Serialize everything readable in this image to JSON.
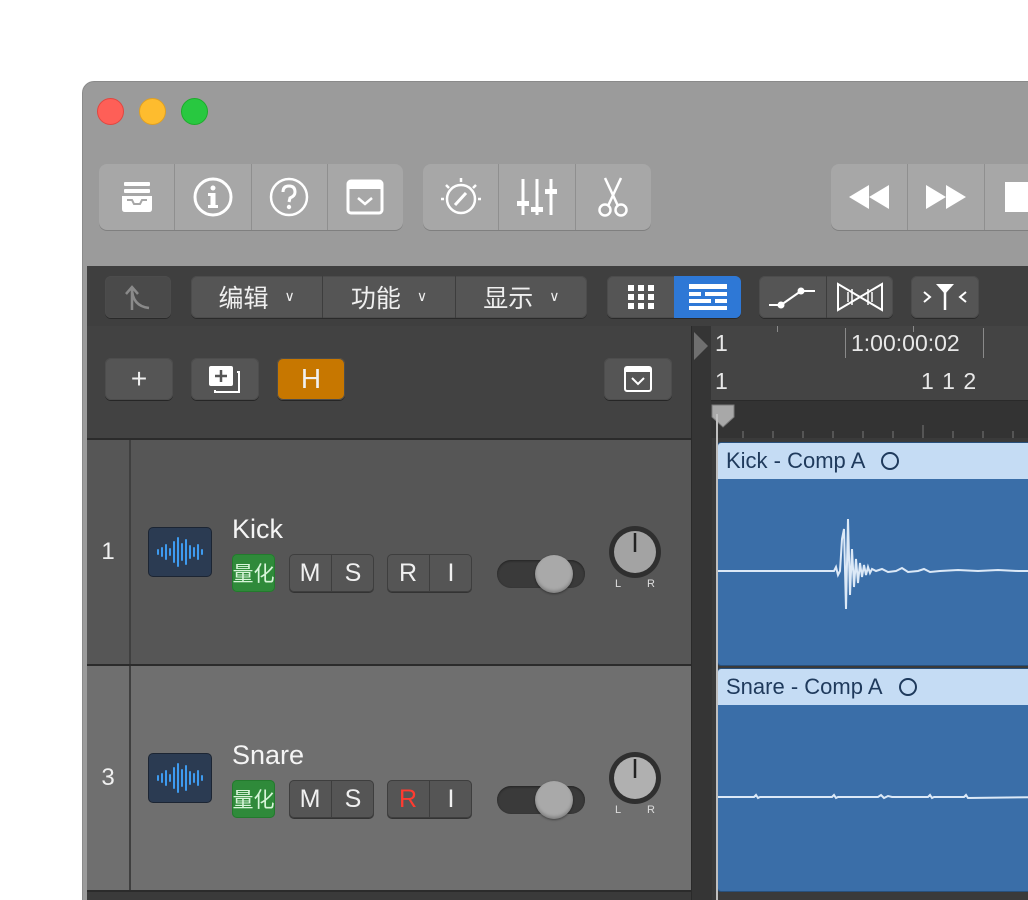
{
  "window": {
    "traffic_lights": [
      "close",
      "minimize",
      "zoom"
    ]
  },
  "toolbar": {
    "group1": [
      "library-icon",
      "info-icon",
      "help-icon",
      "smart-controls-icon"
    ],
    "group2": [
      "tuner-icon",
      "mixer-icon",
      "scissors-icon"
    ],
    "transport": [
      "rewind-icon",
      "fast-forward-icon",
      "stop-icon"
    ]
  },
  "control_bar": {
    "back_icon": "back-arrow-icon",
    "menus": [
      {
        "label": "编辑"
      },
      {
        "label": "功能"
      },
      {
        "label": "显示"
      }
    ],
    "view_buttons": [
      "grid-view-icon",
      "list-view-icon"
    ],
    "active_view": "list-view-icon",
    "automation_icons": [
      "automation-icon",
      "flex-icon"
    ],
    "catch_icon": "catch-playhead-icon"
  },
  "track_header": {
    "add_label": "+",
    "h_label": "H",
    "h_color": "#c77700"
  },
  "ruler": {
    "row1_bar": "1",
    "row1_time": "1:00:00:02",
    "row2_bar": "1",
    "row2_beat": "1 1 2"
  },
  "tracks": [
    {
      "number": "1",
      "name": "Kick",
      "quantize_label": "量化",
      "mute_label": "M",
      "solo_label": "S",
      "read_label": "R",
      "input_label": "I",
      "record_armed": false,
      "pan_left": "L",
      "pan_right": "R"
    },
    {
      "number": "3",
      "name": "Snare",
      "quantize_label": "量化",
      "mute_label": "M",
      "solo_label": "S",
      "read_label": "R",
      "input_label": "I",
      "record_armed": true,
      "pan_left": "L",
      "pan_right": "R"
    }
  ],
  "regions": [
    {
      "name": "Kick - Comp A"
    },
    {
      "name": "Snare - Comp A"
    }
  ],
  "colors": {
    "region_fill": "#3a6ea8",
    "region_header": "#c5dcf4",
    "quantize_green": "#2f8a3a",
    "record_red": "#ff3b30"
  }
}
